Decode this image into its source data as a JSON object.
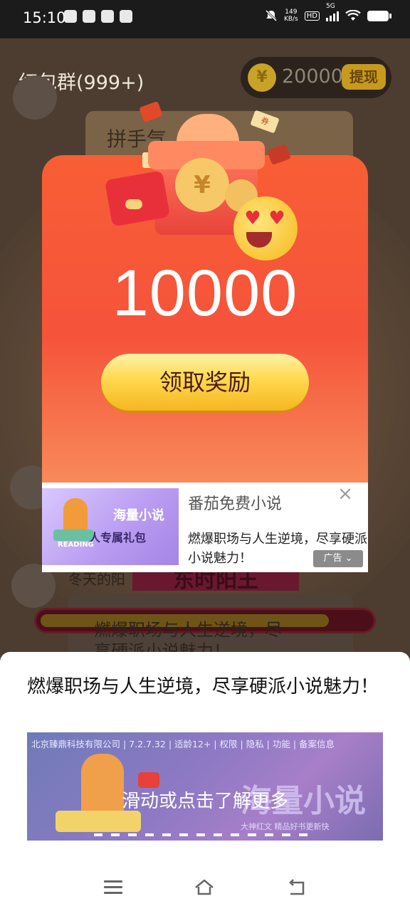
{
  "status_bar": {
    "time": "15:10",
    "network_speed_value": "149",
    "network_speed_unit": "KB/s",
    "hd_badge": "HD",
    "network_type": "5G",
    "icons": [
      "wechat-icon",
      "app-icon",
      "message-icon",
      "app-icon",
      "mute-icon",
      "signal-icon",
      "wifi-icon",
      "battery-icon"
    ]
  },
  "chat": {
    "title": "红包群(999+)",
    "coin_balance": "20000",
    "withdraw_label": "提现",
    "message_preview": "拼手气",
    "sender_preview": "冬天的阳",
    "ribbon_text": "东时阳王",
    "message_line1": "燃爆职场与人生逆境，尽",
    "message_line2": "享硬派小说魅力！"
  },
  "reward": {
    "amount": "10000",
    "claim_label": "领取奖励",
    "coin_symbol": "¥",
    "ticket_text": "券"
  },
  "ad_banner": {
    "thumb_title": "海量小说",
    "thumb_subtitle": "人专属礼包",
    "thumb_reading": "READING",
    "title": "番茄免费小说",
    "description": "燃爆职场与人生逆境，尽享硬派小说魅力！",
    "ad_tag": "广告",
    "close": "×"
  },
  "sheet": {
    "description": "燃爆职场与人生逆境，尽享硬派小说魅力！",
    "video_info": "北京臻鼎科技有限公司 | 7.2.7.32 | 适龄12+ | 权限 | 隐私 | 功能 | 备案信息",
    "video_cta": "滑动或点击了解更多",
    "video_title": "海量小说",
    "video_tagline": "大神红文 精品好书更新快"
  },
  "navbar": {
    "buttons": [
      "menu-icon",
      "home-icon",
      "back-icon"
    ]
  },
  "colors": {
    "reward_card": "#f5533a",
    "claim_button": "#ffd94d",
    "sheet_bg": "#ffffff",
    "backdrop": "#4c3d30"
  },
  "progress_fraction": 0.88
}
